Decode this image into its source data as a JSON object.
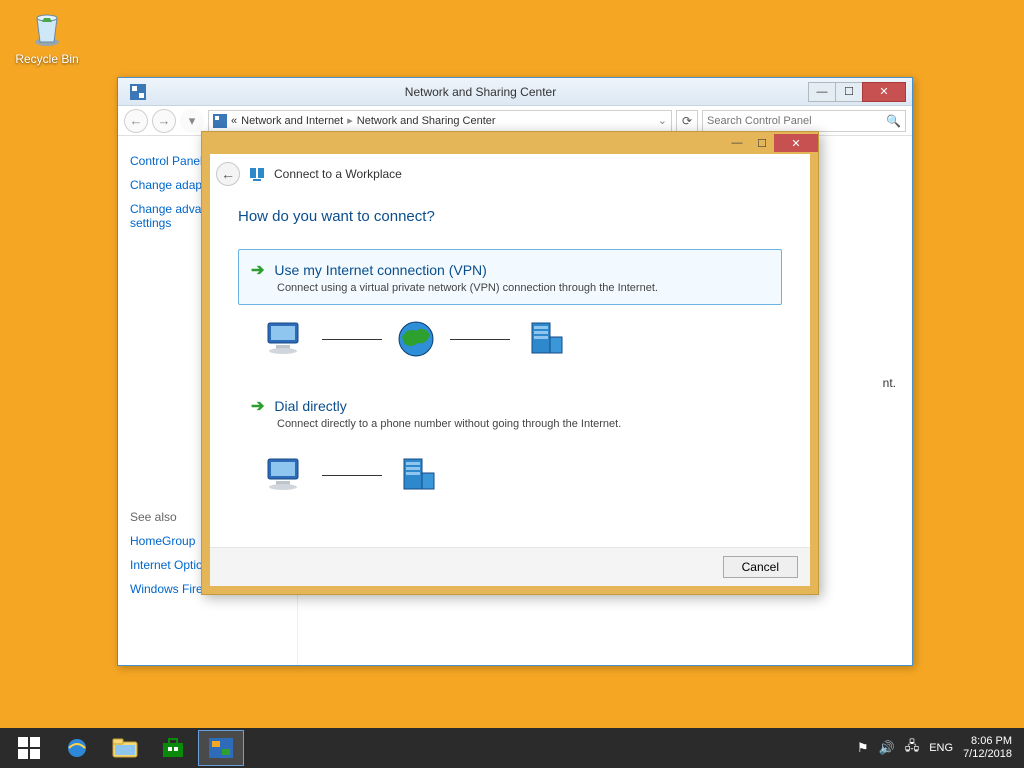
{
  "desktop": {
    "recycle_bin": "Recycle Bin"
  },
  "parent_window": {
    "title": "Network and Sharing Center",
    "breadcrumb": {
      "prefix": "«",
      "level1": "Network and Internet",
      "level2": "Network and Sharing Center"
    },
    "search_placeholder": "Search Control Panel",
    "sidebar": {
      "home": "Control Panel Home",
      "adapter": "Change adapter settings",
      "advanced": "Change advanced sharing settings",
      "see_also": "See also",
      "homegroup": "HomeGroup",
      "inet": "Internet Options",
      "firewall": "Windows Firewall"
    },
    "trailing_text": "nt."
  },
  "wizard": {
    "title": "Connect to a Workplace",
    "question": "How do you want to connect?",
    "opt1": {
      "title": "Use my Internet connection (VPN)",
      "desc": "Connect using a virtual private network (VPN) connection through the Internet."
    },
    "opt2": {
      "title": "Dial directly",
      "desc": "Connect directly to a phone number without going through the Internet."
    },
    "cancel": "Cancel"
  },
  "taskbar": {
    "lang": "ENG",
    "time": "8:06 PM",
    "date": "7/12/2018"
  }
}
